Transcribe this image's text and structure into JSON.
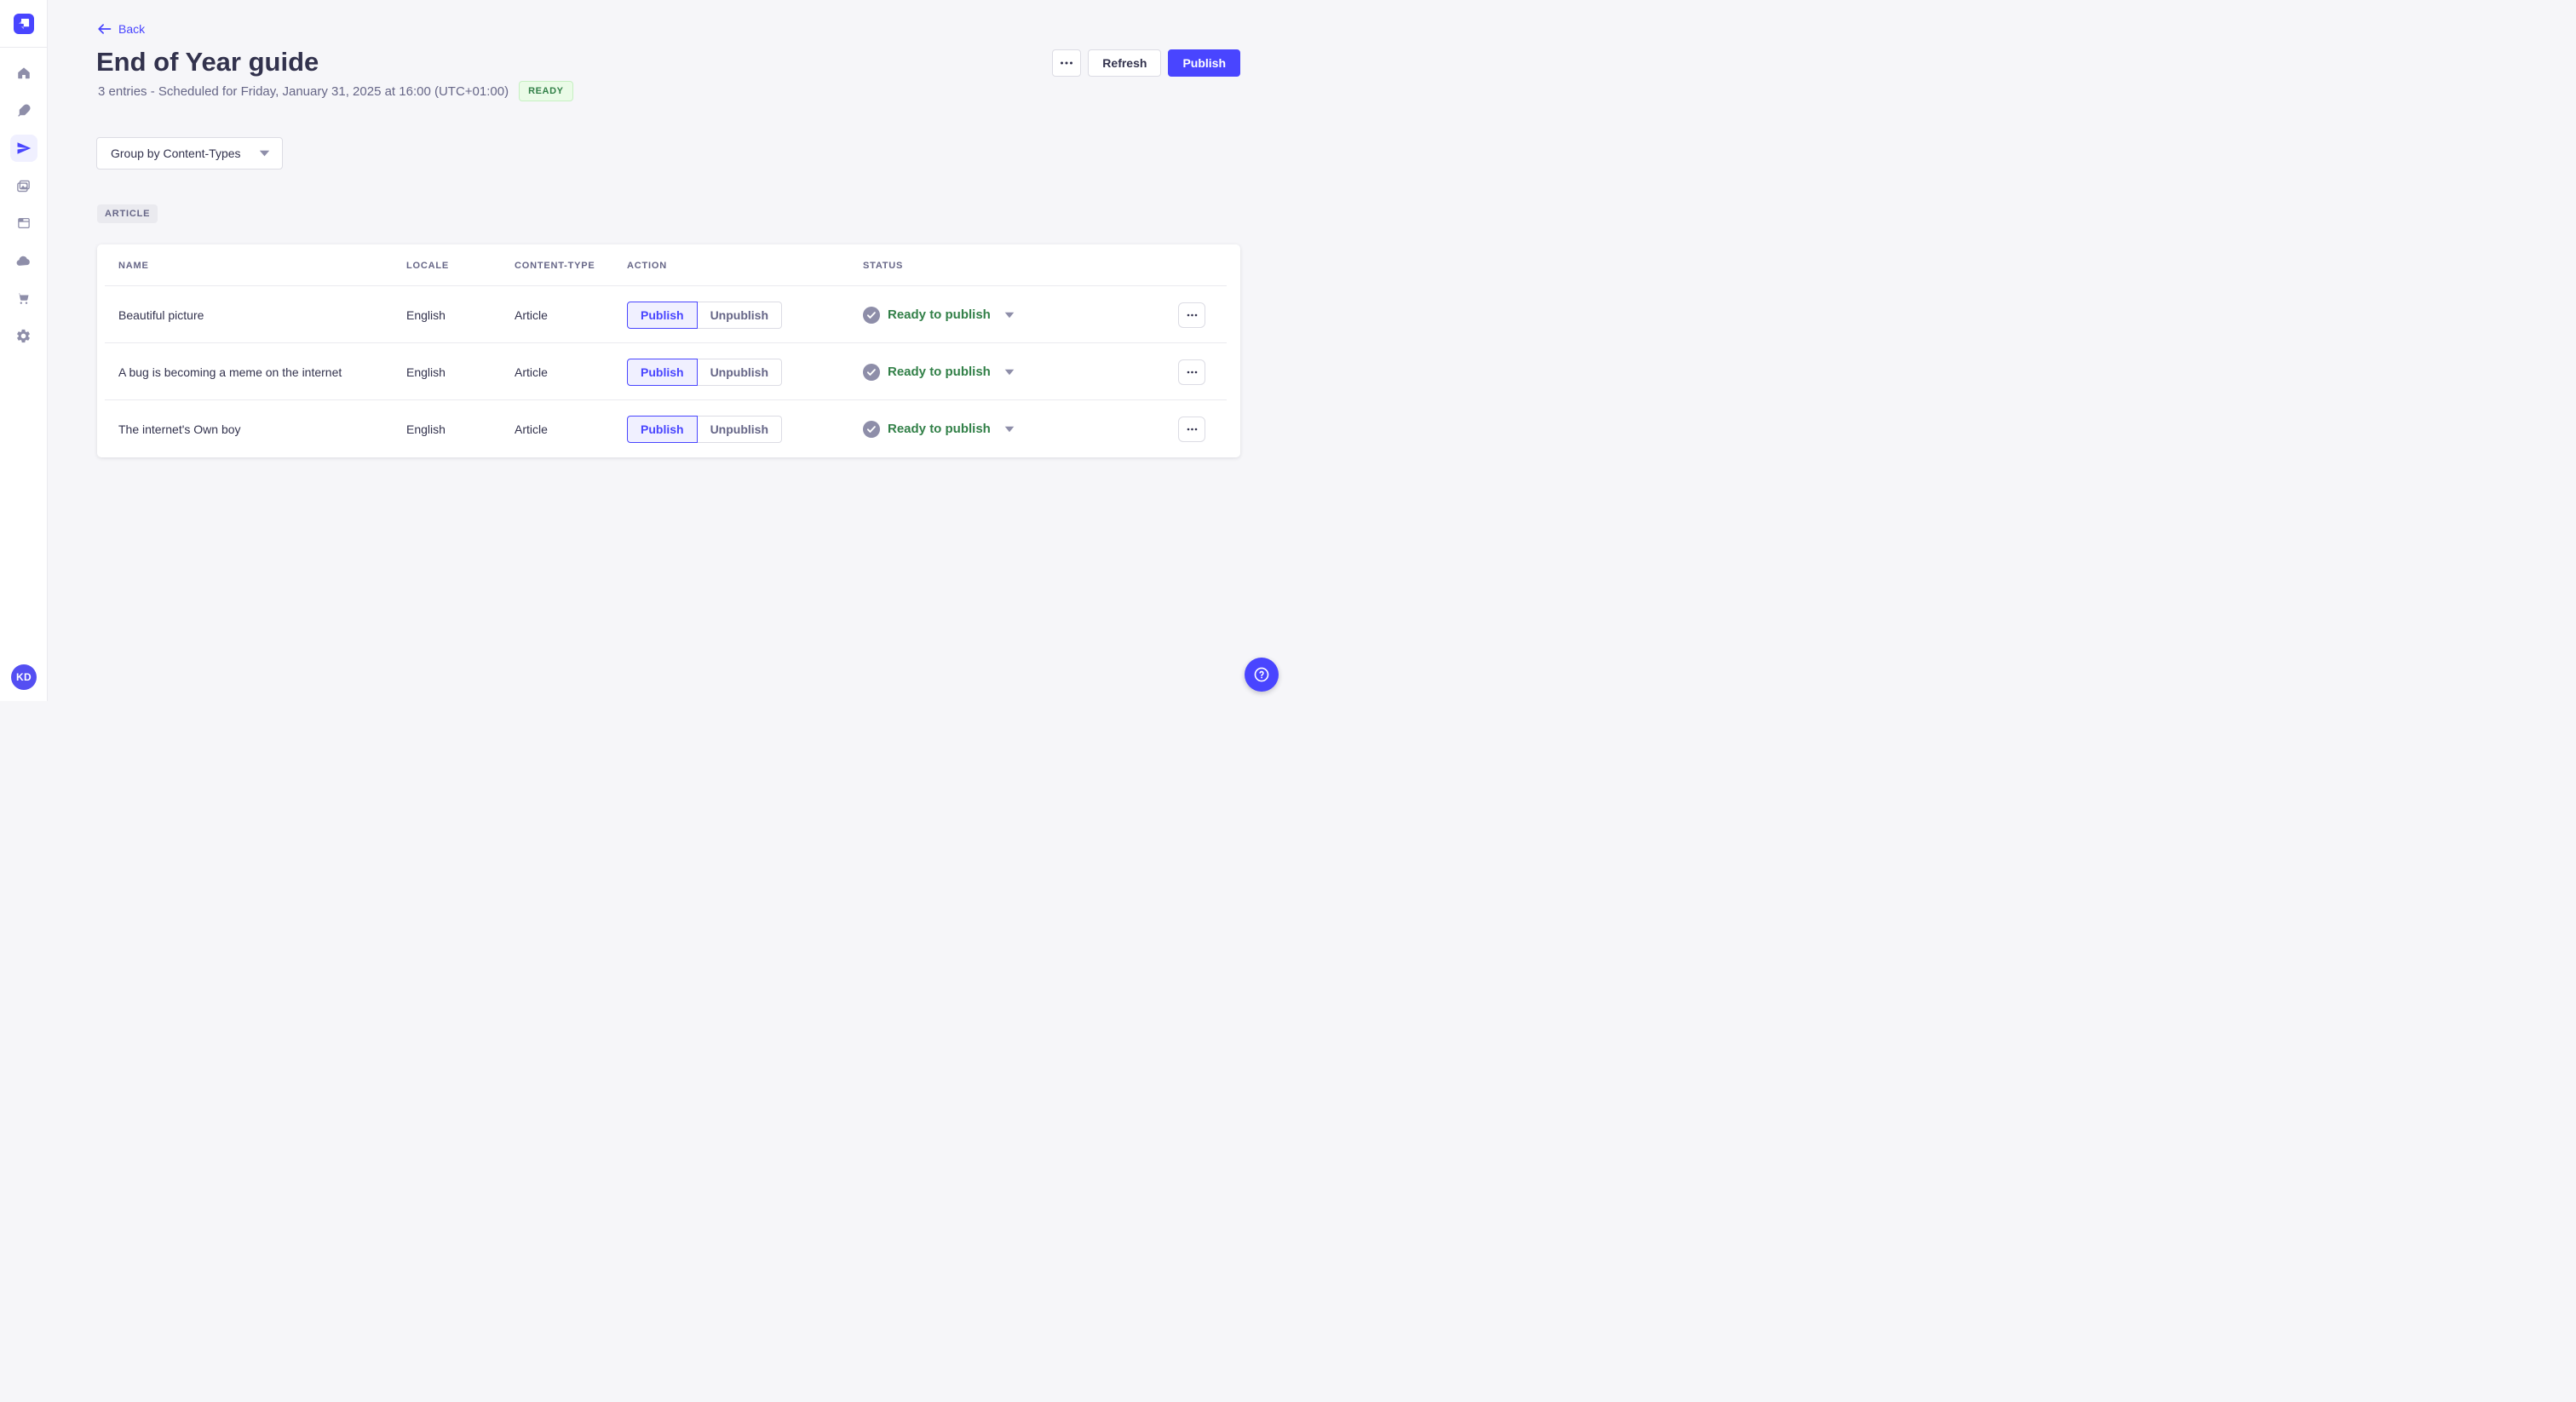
{
  "colors": {
    "accent": "#4945ff",
    "accent_light": "#f0f0ff",
    "success_text": "#328048",
    "success_bg": "#eafbe7",
    "neutral_icon": "#8e8ea9",
    "title_text": "#32324d",
    "muted_text": "#666687"
  },
  "sidebar": {
    "logo_icon": "strapi-logo",
    "items": [
      {
        "icon": "home",
        "active": false
      },
      {
        "icon": "feather-pen",
        "active": false
      },
      {
        "icon": "paper-plane",
        "active": true
      },
      {
        "icon": "media-pictures",
        "active": false
      },
      {
        "icon": "layout-panel",
        "active": false
      },
      {
        "icon": "cloud",
        "active": false
      },
      {
        "icon": "shopping-cart",
        "active": false
      },
      {
        "icon": "gear",
        "active": false
      }
    ],
    "avatar_initials": "KD"
  },
  "header": {
    "back_label": "Back",
    "title": "End of Year guide",
    "subtitle": "3 entries - Scheduled for Friday, January 31, 2025 at 16:00 (UTC+01:00)",
    "status_badge": "READY",
    "refresh_label": "Refresh",
    "publish_label": "Publish",
    "more_icon": "ellipsis"
  },
  "toolbar": {
    "group_by_label": "Group by Content-Types"
  },
  "group": {
    "badge": "ARTICLE"
  },
  "table": {
    "columns": [
      "NAME",
      "LOCALE",
      "CONTENT-TYPE",
      "ACTION",
      "STATUS"
    ],
    "action_publish": "Publish",
    "action_unpublish": "Unpublish",
    "rows": [
      {
        "name": "Beautiful picture",
        "locale": "English",
        "content_type": "Article",
        "status": "Ready to publish"
      },
      {
        "name": "A bug is becoming a meme on the internet",
        "locale": "English",
        "content_type": "Article",
        "status": "Ready to publish"
      },
      {
        "name": "The internet's Own boy",
        "locale": "English",
        "content_type": "Article",
        "status": "Ready to publish"
      }
    ]
  },
  "fab": {
    "icon": "help-question-mark"
  }
}
